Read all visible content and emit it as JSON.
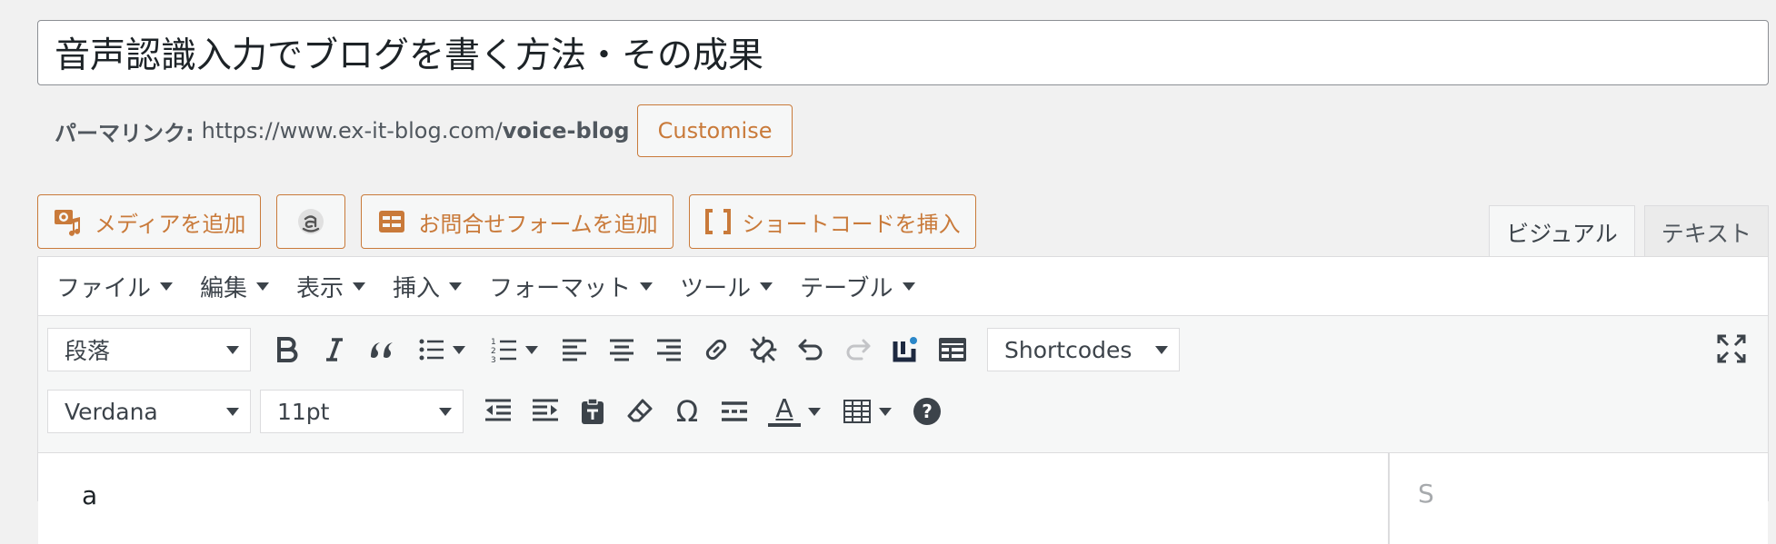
{
  "post": {
    "title": "音声認識入力でブログを書く方法・その成果"
  },
  "permalink": {
    "label": "パーマリンク:",
    "base": "https://www.ex-it-blog.com/",
    "slug": "voice-blog",
    "customise_label": "Customise"
  },
  "media_buttons": {
    "add_media": "メディアを追加",
    "add_form": "お問合せフォームを追加",
    "insert_shortcode": "ショートコードを挿入"
  },
  "tabs": {
    "visual": "ビジュアル",
    "text": "テキスト"
  },
  "menubar": {
    "items": [
      "ファイル",
      "編集",
      "表示",
      "挿入",
      "フォーマット",
      "ツール",
      "テーブル"
    ]
  },
  "toolbar": {
    "format_select": "段落",
    "shortcodes_select": "Shortcodes",
    "font_family": "Verdana",
    "font_size": "11pt",
    "special_char": "Ω",
    "text_color_letter": "A",
    "help_icon": "?"
  },
  "content": {
    "body_text": "a",
    "sidebar_text": "S"
  },
  "colors": {
    "accent": "#c97a3a",
    "text": "#3c434a",
    "border": "#dcdcde"
  }
}
